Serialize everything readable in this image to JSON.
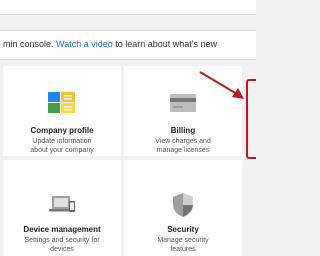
{
  "banner": {
    "prefix": "min console. ",
    "link": "Watch a video",
    "suffix": " to learn about what's new"
  },
  "cards": [
    {
      "title": "Company profile",
      "desc1": "Update information",
      "desc2": "about your company",
      "icon": "company-profile-icon"
    },
    {
      "title": "Billing",
      "desc1": "View charges and",
      "desc2": "manage licenses",
      "icon": "credit-card-icon"
    },
    {
      "title": "Device management",
      "desc1": "Settings and security for",
      "desc2": "devices",
      "icon": "devices-icon"
    },
    {
      "title": "Security",
      "desc1": "Manage security",
      "desc2": "features",
      "icon": "shield-icon"
    }
  ],
  "colors": {
    "link": "#1a73e8",
    "annotation": "#b71c1c"
  }
}
